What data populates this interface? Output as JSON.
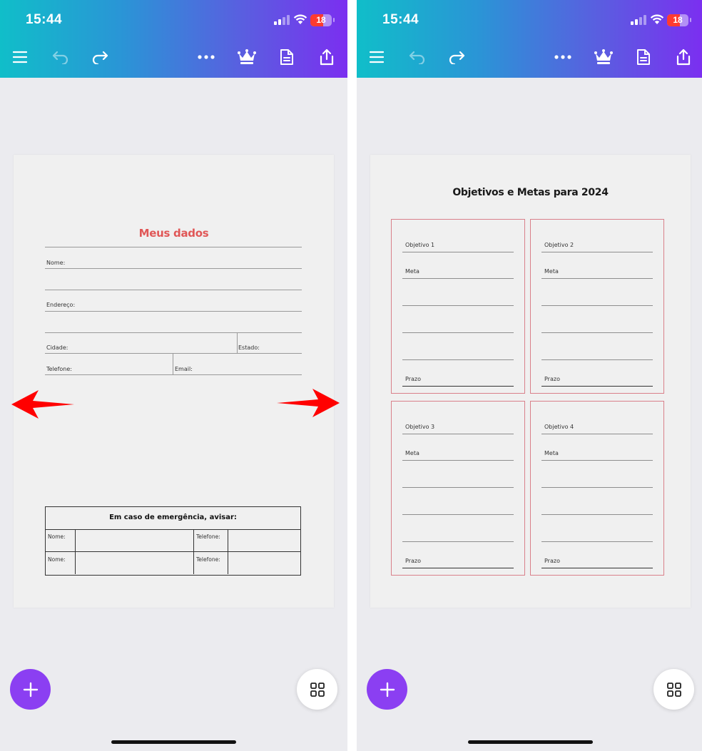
{
  "status_bar": {
    "time": "15:44",
    "battery": "18",
    "battery_level": 0.18
  },
  "toolbar": {
    "icons": [
      "menu-icon",
      "undo-icon",
      "redo-icon",
      "more-icon",
      "crown-icon",
      "document-icon",
      "share-icon"
    ]
  },
  "pages": {
    "form": {
      "title": "Meus dados",
      "labels": {
        "nome": "Nome:",
        "endereco": "Endereço:",
        "cidade": "Cidade:",
        "estado": "Estado:",
        "telefone": "Telefone:",
        "email": "Email:"
      },
      "emergency": {
        "title": "Em caso de emergência, avisar:",
        "rows": [
          {
            "name_label": "Nome:",
            "phone_label": "Telefone:"
          },
          {
            "name_label": "Nome:",
            "phone_label": "Telefone:"
          }
        ]
      }
    },
    "goals": {
      "title": "Objetivos e Metas para 2024",
      "boxes": [
        {
          "objective": "Objetivo 1",
          "goal": "Meta",
          "deadline": "Prazo"
        },
        {
          "objective": "Objetivo 2",
          "goal": "Meta",
          "deadline": "Prazo"
        },
        {
          "objective": "Objetivo 3",
          "goal": "Meta",
          "deadline": "Prazo"
        },
        {
          "objective": "Objetivo 4",
          "goal": "Meta",
          "deadline": "Prazo"
        }
      ]
    }
  },
  "colors": {
    "header_gradient": [
      "#10bec9",
      "#7b2ff0"
    ],
    "fab": "#8b3ff2",
    "form_title": "#e05757",
    "goal_border": "#d9808a",
    "arrow": "#ff0000"
  },
  "fab": {
    "add_icon": "plus-icon",
    "grid_icon": "grid-icon"
  },
  "annotations": {
    "left_arrow": "arrow-left-icon",
    "right_arrow": "arrow-right-icon"
  }
}
